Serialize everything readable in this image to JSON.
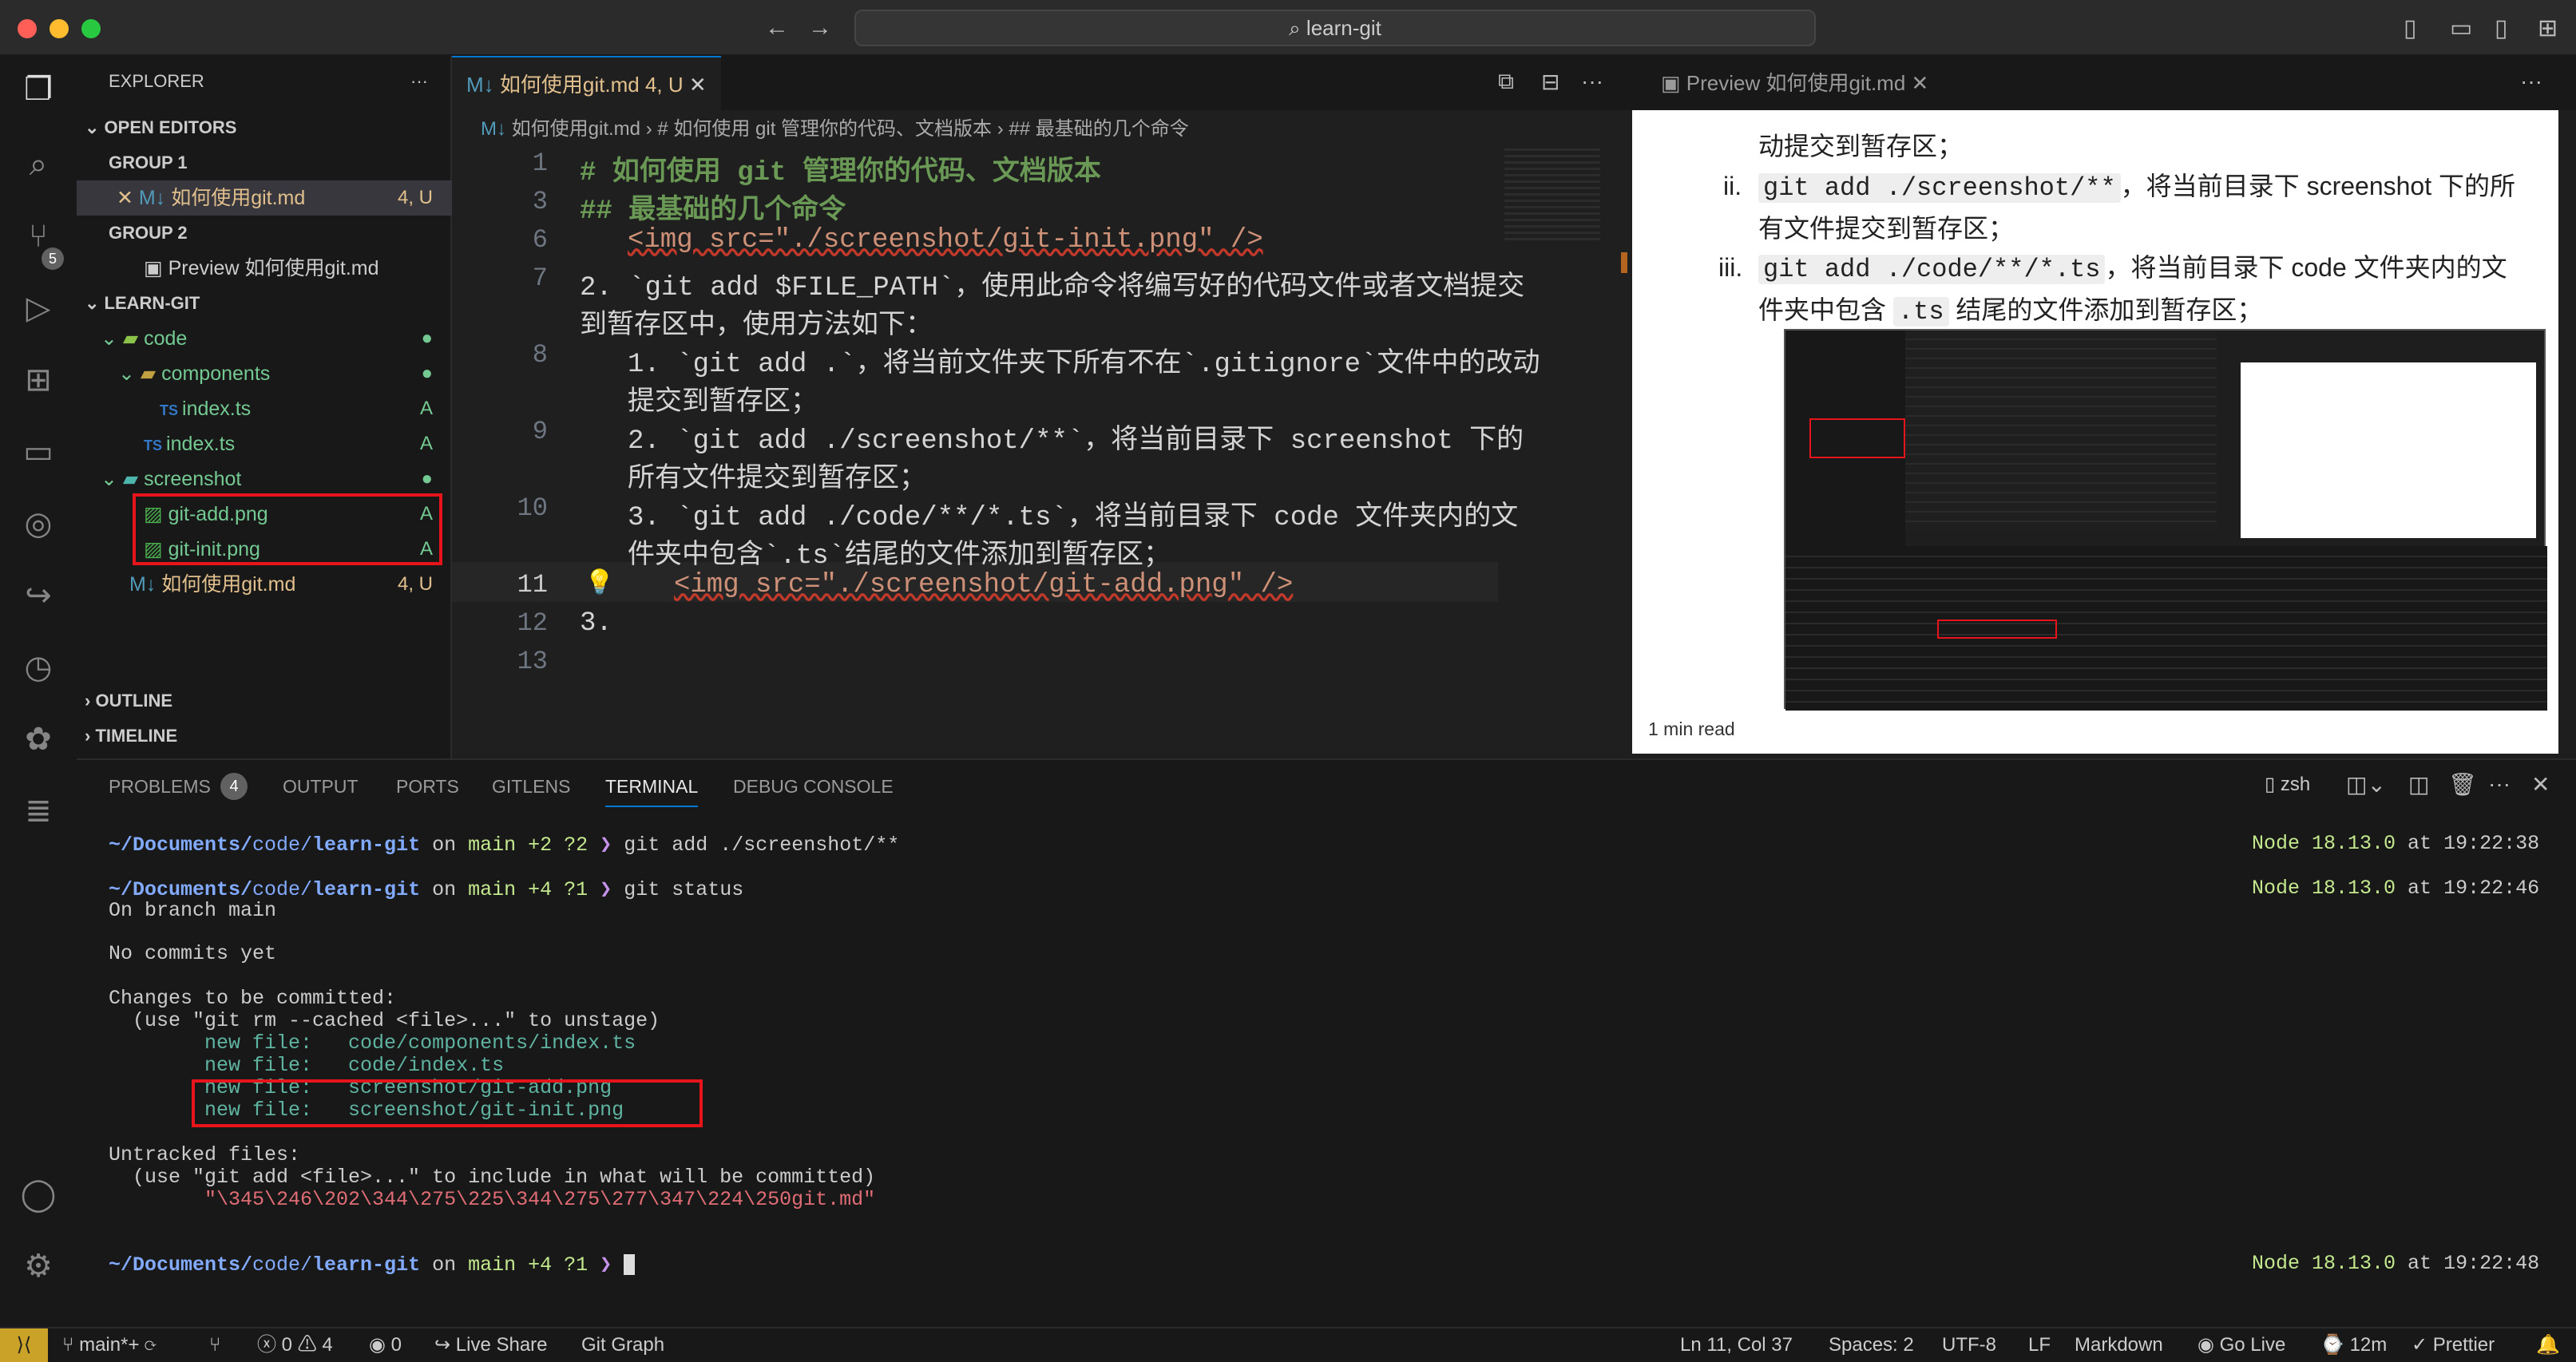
{
  "window": {
    "title": "learn-git"
  },
  "explorer": {
    "title": "EXPLORER",
    "open_editors": "OPEN EDITORS",
    "group1": "GROUP 1",
    "group1_file": "如何使用git.md",
    "group1_status": "4, U",
    "group2": "GROUP 2",
    "group2_file": "Preview 如何使用git.md",
    "root": "LEARN-GIT",
    "items": [
      {
        "label": "code",
        "status": ""
      },
      {
        "label": "components",
        "status": ""
      },
      {
        "label": "index.ts",
        "status": "A"
      },
      {
        "label": "index.ts",
        "status": "A"
      },
      {
        "label": "screenshot",
        "status": ""
      },
      {
        "label": "git-add.png",
        "status": "A"
      },
      {
        "label": "git-init.png",
        "status": "A"
      },
      {
        "label": "如何使用git.md",
        "status": "4, U"
      }
    ],
    "outline": "OUTLINE",
    "timeline": "TIMELINE"
  },
  "editor": {
    "tab_label": "如何使用git.md",
    "tab_status": "4, U",
    "breadcrumb": [
      "如何使用git.md",
      "# 如何使用 git 管理你的代码、文档版本",
      "## 最基础的几个命令"
    ],
    "lines": [
      {
        "n": "1",
        "text": "# 如何使用 git 管理你的代码、文档版本"
      },
      {
        "n": "3",
        "text": "## 最基础的几个命令"
      },
      {
        "n": "6",
        "text": "<img src=\"./screenshot/git-init.png\" />"
      },
      {
        "n": "7",
        "text": "2. `git add $FILE_PATH`，使用此命令将编写好的代码文件或者文档提交"
      },
      {
        "n": "",
        "text": "到暂存区中，使用方法如下："
      },
      {
        "n": "8",
        "text": "1. `git add .`，将当前文件夹下所有不在`.gitignore`文件中的改动"
      },
      {
        "n": "",
        "text": "提交到暂存区；"
      },
      {
        "n": "9",
        "text": "2. `git add ./screenshot/**`，将当前目录下 screenshot 下的"
      },
      {
        "n": "",
        "text": "所有文件提交到暂存区；"
      },
      {
        "n": "10",
        "text": "3. `git add ./code/**/*.ts`，将当前目录下 code 文件夹内的文"
      },
      {
        "n": "",
        "text": "件夹中包含`.ts`结尾的文件添加到暂存区；"
      },
      {
        "n": "11",
        "text": "<img src=\"./screenshot/git-add.png\" />"
      },
      {
        "n": "12",
        "text": "3."
      },
      {
        "n": "13",
        "text": ""
      }
    ]
  },
  "preview": {
    "tab_label": "Preview 如何使用git.md",
    "top_text": "动提交到暂存区；",
    "items": [
      {
        "marker": "ii.",
        "code": "git add ./screenshot/**",
        "text": "，将当前目录下 screenshot 下的所",
        "text2": "有文件提交到暂存区；"
      },
      {
        "marker": "iii.",
        "code": "git add ./code/**/*.ts",
        "text": "，将当前目录下 code 文件夹内的文",
        "text2_pre": "件夹中包含 ",
        "text2_code": ".ts",
        "text2_post": " 结尾的文件添加到暂存区；"
      }
    ],
    "footer": "1 min read"
  },
  "panel": {
    "tabs": [
      "PROBLEMS",
      "OUTPUT",
      "PORTS",
      "GITLENS",
      "TERMINAL",
      "DEBUG CONSOLE"
    ],
    "problems_count": "4",
    "shell": "zsh",
    "terminal": {
      "prompt_path_pre": "~/Documents/",
      "prompt_path_mid": "code/",
      "prompt_path_end": "learn-git",
      "on": "on",
      "branch1": "main +2 ?2",
      "branch2": "main +4 ?1",
      "cmd1": "git add ./screenshot/**",
      "cmd2": "git status",
      "node1": "Node 18.13.0",
      "at": "at",
      "time1": "19:22:38",
      "time2": "19:22:46",
      "time3": "19:22:48",
      "out": [
        "On branch main",
        "",
        "No commits yet",
        "",
        "Changes to be committed:",
        "  (use \"git rm --cached <file>...\" to unstage)"
      ],
      "new_files": [
        "        new file:   code/components/index.ts",
        "        new file:   code/index.ts",
        "        new file:   screenshot/git-add.png",
        "        new file:   screenshot/git-init.png"
      ],
      "untracked_title": "Untracked files:",
      "untracked_hint": "  (use \"git add <file>...\" to include in what will be committed)",
      "untracked_file": "        \"\\345\\246\\202\\344\\275\\225\\344\\275\\277\\347\\224\\250git.md\""
    }
  },
  "status": {
    "branch": "main*+",
    "errors": "0",
    "warnings": "4",
    "ports": "0",
    "live_share": "Live Share",
    "git_graph": "Git Graph",
    "position": "Ln 11, Col 37",
    "spaces": "Spaces: 2",
    "encoding": "UTF-8",
    "eol": "LF",
    "language": "Markdown",
    "go_live": "Go Live",
    "time": "12m",
    "prettier": "Prettier"
  },
  "colors": {
    "accent": "#0078d4",
    "highlight_box": "#e8141c",
    "git_added": "#73c991",
    "git_modified": "#e2c08d"
  }
}
